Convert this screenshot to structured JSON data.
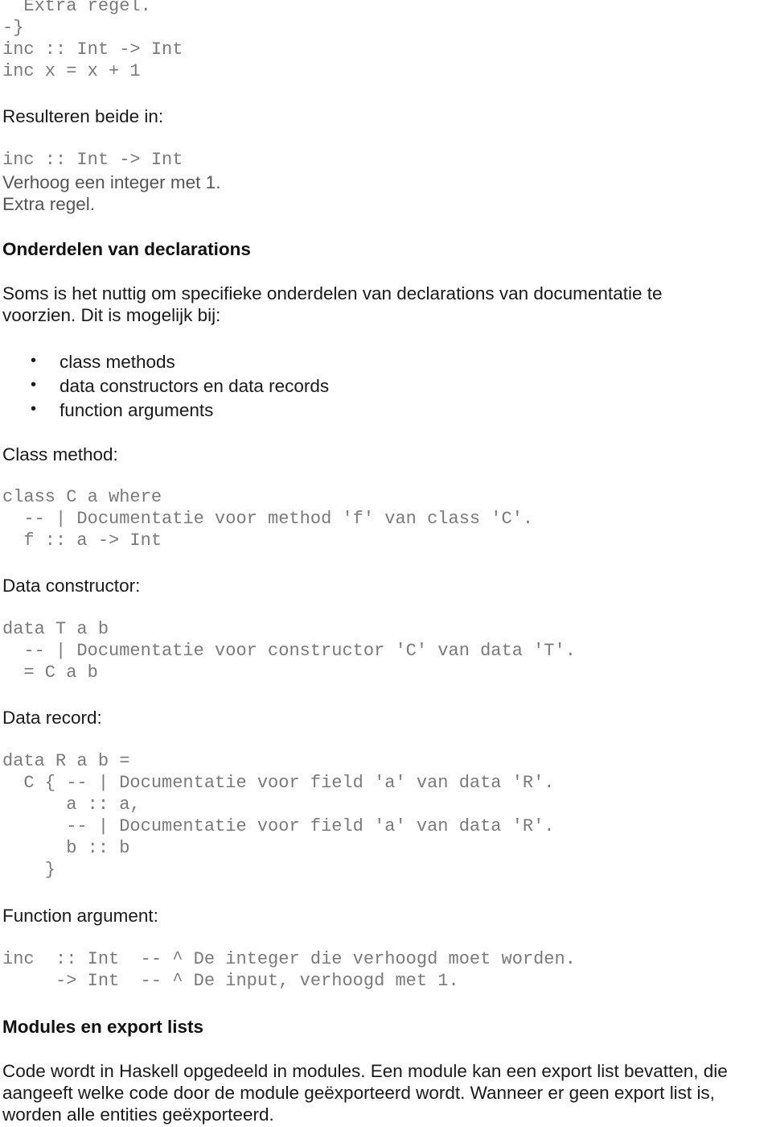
{
  "top_code": [
    "  Extra regel.",
    "-}",
    "inc :: Int -> Int",
    "inc x = x + 1"
  ],
  "result_intro": "Resulteren beide in:",
  "result_signature": "inc :: Int -> Int",
  "result_doc": [
    "Verhoog een integer met 1.",
    "Extra regel."
  ],
  "section_declarations": {
    "heading": "Onderdelen van declarations",
    "paragraph": [
      "Soms is het nuttig om specifieke onderdelen van declarations van documentatie te",
      "voorzien. Dit is mogelijk bij:"
    ],
    "bullets": [
      "class methods",
      "data constructors en data records",
      "function arguments"
    ]
  },
  "class_method": {
    "label": "Class method:",
    "code": [
      "class C a where",
      "  -- | Documentatie voor method 'f' van class 'C'.",
      "  f :: a -> Int"
    ]
  },
  "data_constructor": {
    "label": "Data constructor:",
    "code": [
      "data T a b",
      "  -- | Documentatie voor constructor 'C' van data 'T'.",
      "  = C a b"
    ]
  },
  "data_record": {
    "label": "Data record:",
    "code": [
      "data R a b =",
      "  C { -- | Documentatie voor field 'a' van data 'R'.",
      "      a :: a,",
      "      -- | Documentatie voor field 'a' van data 'R'.",
      "      b :: b",
      "    }"
    ]
  },
  "function_argument": {
    "label": "Function argument:",
    "code": [
      "inc  :: Int  -- ^ De integer die verhoogd moet worden.",
      "     -> Int  -- ^ De input, verhoogd met 1."
    ]
  },
  "section_modules": {
    "heading": "Modules en export lists",
    "paragraph": [
      "Code wordt in Haskell opgedeeld in modules. Een module kan een export list bevatten, die",
      "aangeeft welke code door de module geëxporteerd wordt. Wanneer er geen export list is,",
      "worden alle entities geëxporteerd."
    ]
  }
}
